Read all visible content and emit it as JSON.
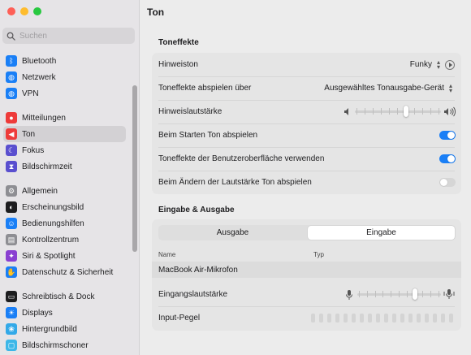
{
  "window": {
    "title": "Ton"
  },
  "sidebar": {
    "search_placeholder": "Suchen",
    "items": [
      {
        "label": "Bluetooth",
        "icon": "bluetooth-icon",
        "color": "#1a7ff6",
        "glyph": "ᛒ"
      },
      {
        "label": "Netzwerk",
        "icon": "globe-icon",
        "color": "#1a7ff6",
        "glyph": "◍"
      },
      {
        "label": "VPN",
        "icon": "vpn-globe-icon",
        "color": "#1a7ff6",
        "glyph": "◍"
      },
      {
        "label": "Mitteilungen",
        "icon": "bell-icon",
        "color": "#ee3b3a",
        "glyph": "●"
      },
      {
        "label": "Ton",
        "icon": "speaker-icon",
        "color": "#ee3b3a",
        "glyph": "◀"
      },
      {
        "label": "Fokus",
        "icon": "moon-icon",
        "color": "#5a4fcf",
        "glyph": "☾"
      },
      {
        "label": "Bildschirmzeit",
        "icon": "hourglass-icon",
        "color": "#5a4fcf",
        "glyph": "⧗"
      },
      {
        "label": "Allgemein",
        "icon": "gear-icon",
        "color": "#8e8e93",
        "glyph": "⚙"
      },
      {
        "label": "Erscheinungsbild",
        "icon": "appearance-icon",
        "color": "#1d1d1f",
        "glyph": "◐"
      },
      {
        "label": "Bedienungshilfen",
        "icon": "accessibility-icon",
        "color": "#1a7ff6",
        "glyph": "☺"
      },
      {
        "label": "Kontrollzentrum",
        "icon": "control-center-icon",
        "color": "#8e8e93",
        "glyph": "▤"
      },
      {
        "label": "Siri & Spotlight",
        "icon": "siri-icon",
        "color": "#8a3fd1",
        "glyph": "✦"
      },
      {
        "label": "Datenschutz & Sicherheit",
        "icon": "hand-icon",
        "color": "#1a7ff6",
        "glyph": "✋"
      },
      {
        "label": "Schreibtisch & Dock",
        "icon": "dock-icon",
        "color": "#1d1d1f",
        "glyph": "▭"
      },
      {
        "label": "Displays",
        "icon": "sun-icon",
        "color": "#1a7ff6",
        "glyph": "☀"
      },
      {
        "label": "Hintergrundbild",
        "icon": "wallpaper-icon",
        "color": "#33a9e8",
        "glyph": "❀"
      },
      {
        "label": "Bildschirmschoner",
        "icon": "screensaver-icon",
        "color": "#3db7e8",
        "glyph": "▢"
      }
    ],
    "selected": "Ton"
  },
  "main": {
    "title": "Ton",
    "toneffekte": {
      "heading": "Toneffekte",
      "hinweiston_label": "Hinweiston",
      "hinweiston_value": "Funky",
      "abspielen_label": "Toneffekte abspielen über",
      "abspielen_value": "Ausgewähltes Tonausgabe-Gerät",
      "lautstaerke_label": "Hinweislautstärke",
      "lautstaerke_level": 0.6,
      "starten_label": "Beim Starten Ton abspielen",
      "starten_on": true,
      "oberflaeche_label": "Toneffekte der Benutzeroberfläche verwenden",
      "oberflaeche_on": true,
      "aendern_label": "Beim Ändern der Lautstärke Ton abspielen",
      "aendern_on": false
    },
    "io": {
      "heading": "Eingabe & Ausgabe",
      "tabs": [
        "Ausgabe",
        "Eingabe"
      ],
      "active_tab": "Eingabe",
      "col_name": "Name",
      "col_typ": "Typ",
      "device_name": "MacBook Air-Mikrofon",
      "device_type": "",
      "eingang_label": "Eingangslautstärke",
      "eingang_level": 0.7,
      "pegel_label": "Input-Pegel"
    }
  },
  "colors": {
    "accent": "#1a7ff6"
  }
}
